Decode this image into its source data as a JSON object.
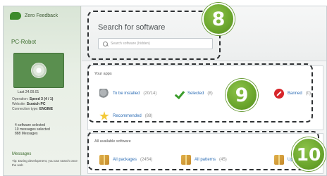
{
  "sidebar": {
    "brand": "Zero Feedback",
    "pc_name": "PC-Robot",
    "pc_status": "Last 24.09.01",
    "system_lines": [
      {
        "label": "Operation",
        "value": "Speed 3 (4 / 1)"
      },
      {
        "label": "Website",
        "value": "Scratch PC"
      },
      {
        "label": "Connection type",
        "value": "ENGINE"
      }
    ],
    "counts": [
      "4 software selected",
      "10 messages selected",
      "888 Messages"
    ],
    "messages_title": "Messages",
    "messages_body": "Tip: During development, you can search once the web"
  },
  "search": {
    "title": "Search for software",
    "placeholder": "Search software (hidden)"
  },
  "your_apps": {
    "title": "Your apps",
    "items": [
      {
        "name": "To be installed",
        "count": "(20/14)",
        "icon": "wrench-icon"
      },
      {
        "name": "Selected",
        "count": "(8)",
        "icon": "checkmark-icon"
      },
      {
        "name": "Banned",
        "count": "(0)",
        "icon": "ban-icon"
      },
      {
        "name": "Recommended",
        "count": "(88)",
        "icon": "star-icon"
      }
    ]
  },
  "all_software": {
    "title": "All available software",
    "items": [
      {
        "name": "All packages",
        "count": "(2454)",
        "icon": "package-icon"
      },
      {
        "name": "All patterns",
        "count": "(45)",
        "icon": "package-icon"
      },
      {
        "name": "Uploaded",
        "count": "",
        "icon": "package-icon"
      }
    ]
  },
  "callouts": [
    "8",
    "9",
    "10"
  ],
  "colors": {
    "accent_green": "#6aa52c",
    "link_blue": "#2c6db5",
    "ban_red": "#d7262b"
  }
}
